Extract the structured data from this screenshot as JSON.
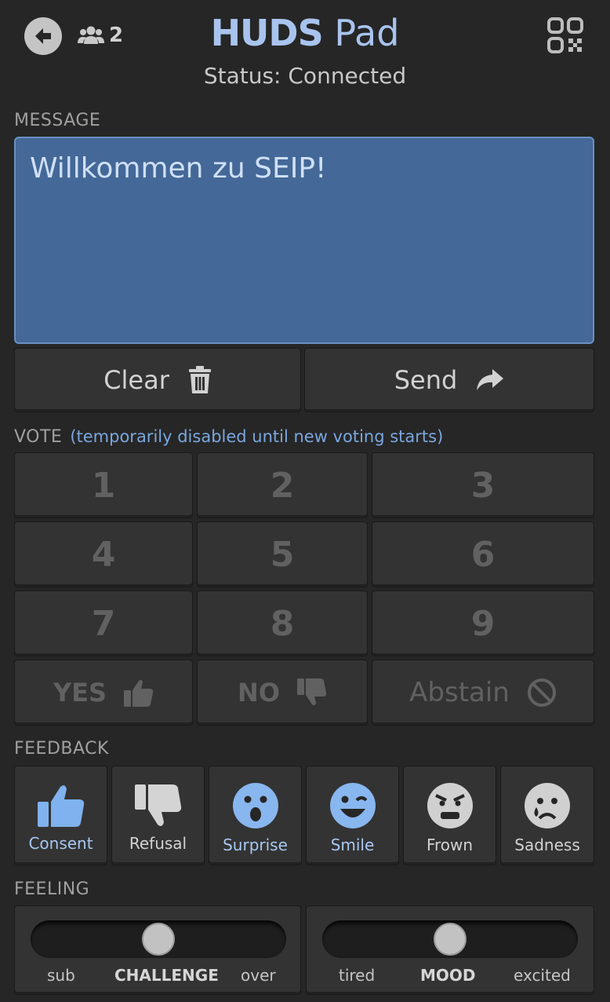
{
  "header": {
    "title_bold": "HUDS",
    "title_light": "Pad",
    "user_count": "2",
    "status": "Status: Connected"
  },
  "message": {
    "label": "MESSAGE",
    "text": "Willkommen zu SEIP!",
    "clear_label": "Clear",
    "send_label": "Send"
  },
  "vote": {
    "label": "VOTE",
    "note": "(temporarily disabled until new voting starts)",
    "numbers": [
      "1",
      "2",
      "3",
      "4",
      "5",
      "6",
      "7",
      "8",
      "9"
    ],
    "yes_label": "YES",
    "no_label": "NO",
    "abstain_label": "Abstain"
  },
  "feedback": {
    "label": "FEEDBACK",
    "items": [
      {
        "label": "Consent",
        "icon": "thumbs-up-icon"
      },
      {
        "label": "Refusal",
        "icon": "thumbs-down-icon"
      },
      {
        "label": "Surprise",
        "icon": "surprised-face-icon"
      },
      {
        "label": "Smile",
        "icon": "wink-face-icon"
      },
      {
        "label": "Frown",
        "icon": "angry-face-icon"
      },
      {
        "label": "Sadness",
        "icon": "sad-tear-face-icon"
      }
    ]
  },
  "feeling": {
    "label": "FEELING",
    "challenge": {
      "left": "sub",
      "name": "CHALLENGE",
      "right": "over",
      "value": 0.5
    },
    "mood": {
      "left": "tired",
      "name": "MOOD",
      "right": "excited",
      "value": 0.5
    }
  },
  "colors": {
    "background": "#262626",
    "accent": "#a8c4ee",
    "message_bg": "#446897",
    "button_bg": "#333333"
  }
}
